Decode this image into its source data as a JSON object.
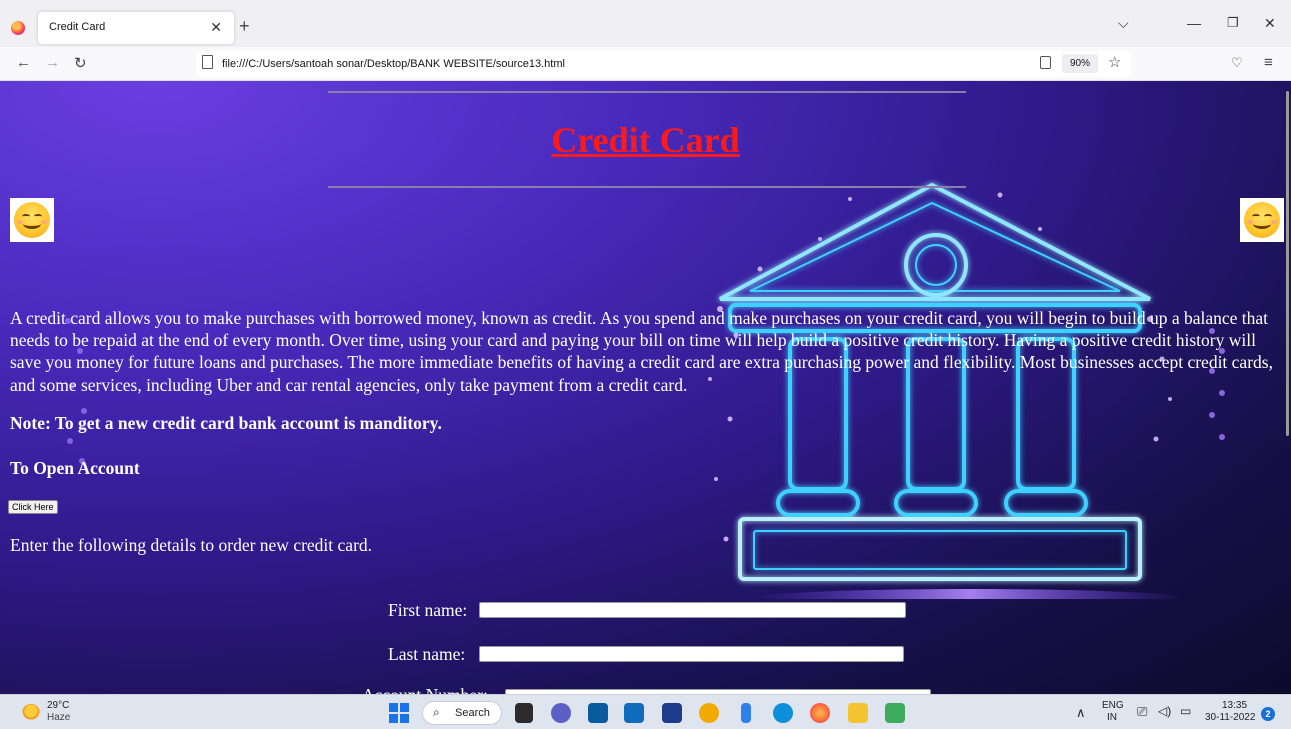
{
  "browser": {
    "tab_title": "Credit Card",
    "url": "file:///C:/Users/santoah sonar/Desktop/BANK WEBSITE/source13.html",
    "zoom": "90%"
  },
  "page": {
    "title": "Credit Card",
    "description": "A credit card allows you to make purchases with borrowed money, known as credit. As you spend and make purchases on your credit card, you will begin to build up a balance that needs to be repaid at the end of every month. Over time, using your card and paying your bill on time will help build a positive credit history. Having a positive credit history will save you money for future loans and purchases. The more immediate benefits of having a credit card are extra purchasing power and flexibility. Most businesses accept credit cards, and some services, including Uber and car rental agencies, only take payment from a credit card.",
    "note": "Note: To get a new credit card bank account is manditory.",
    "open_account_heading": "To Open Account",
    "click_button": "Click Here",
    "form_intro": "Enter the following details to order new credit card.",
    "form": {
      "first_name_label": "First name:",
      "last_name_label": "Last name:",
      "account_number_label": "Account Number:"
    }
  },
  "taskbar": {
    "weather_temp": "29°C",
    "weather_desc": "Haze",
    "search_label": "Search",
    "lang_top": "ENG",
    "lang_bottom": "IN",
    "time": "13:35",
    "date": "30-11-2022",
    "notification_count": "2"
  },
  "colors": {
    "title_red": "#ff1a1a",
    "bank_glow": "#3fd0ff"
  }
}
